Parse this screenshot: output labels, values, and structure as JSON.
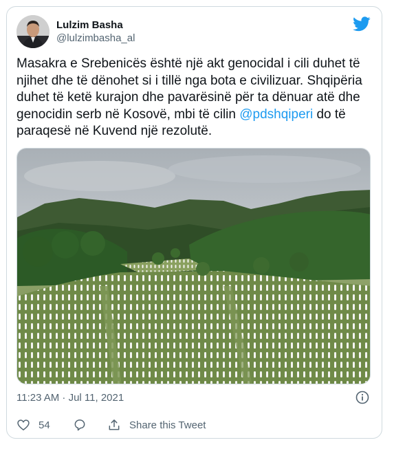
{
  "author": {
    "display_name": "Lulzim Basha",
    "handle": "@lulzimbasha_al"
  },
  "tweet": {
    "text_before": "Masakra e Srebenicës është një akt genocidal i cili duhet të njihet dhe të dënohet si i tillë nga bota e civilizuar. Shqipëria duhet të ketë kurajon dhe pavarësinë për ta dënuar atë dhe genocidin serb në Kosovë, mbi të cilin ",
    "mention": "@pdshqiperi",
    "text_after": " do të paraqesë në Kuvend një rezolutë."
  },
  "timestamp": "11:23 AM · Jul 11, 2021",
  "actions": {
    "like_count": "54",
    "share_label": "Share this Tweet"
  },
  "icons": {
    "brand": "twitter-bird-icon",
    "like": "heart-icon",
    "reply": "reply-icon",
    "share": "share-icon",
    "info": "info-icon"
  },
  "colors": {
    "brand": "#1d9bf0",
    "text": "#0f1419",
    "muted": "#536471",
    "border": "#cfd9de"
  }
}
